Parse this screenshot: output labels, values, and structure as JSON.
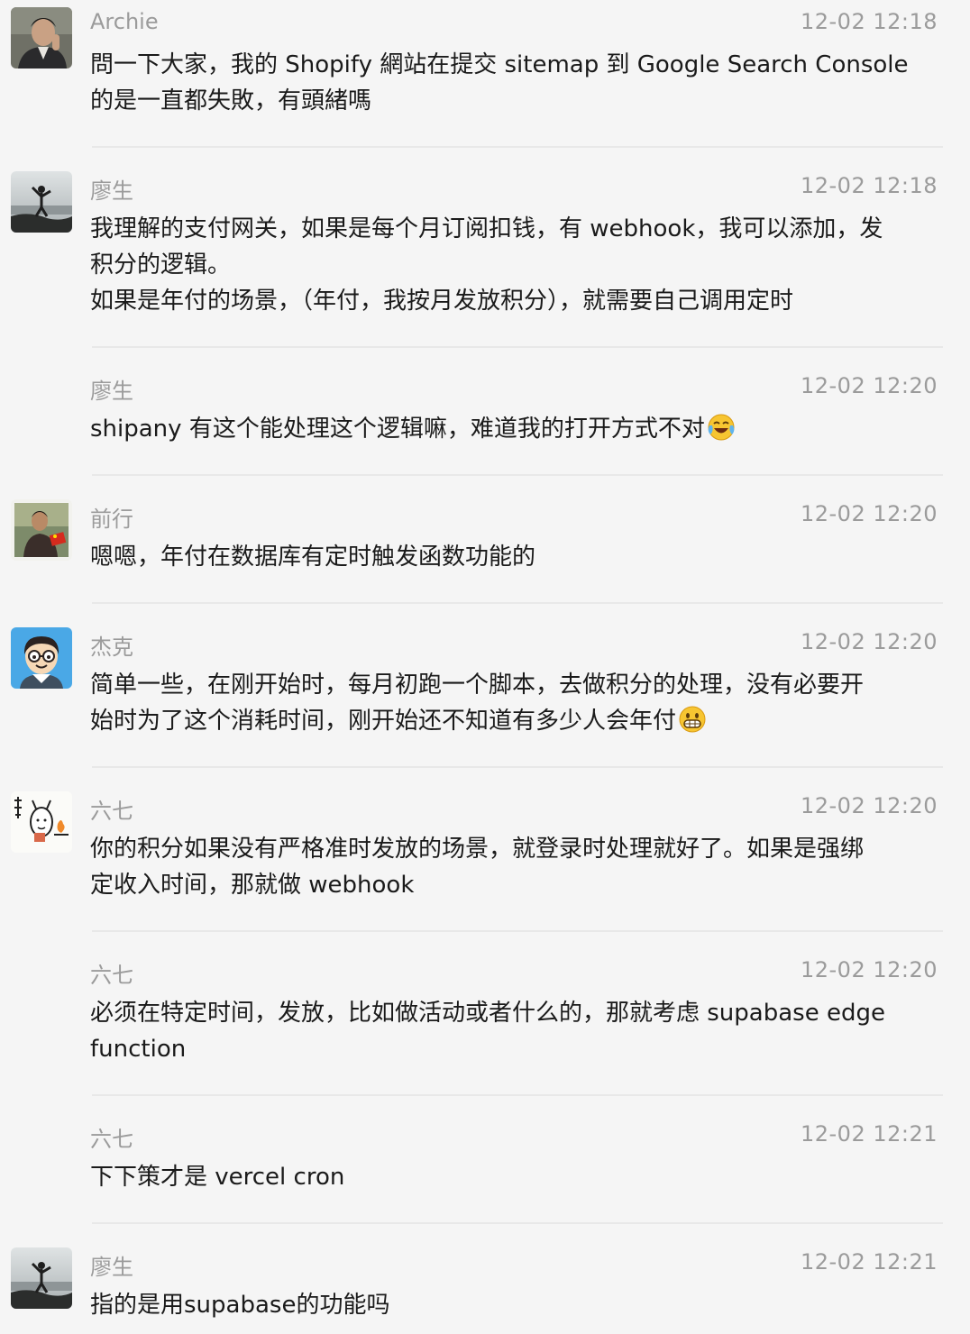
{
  "messages": [
    {
      "sender": "Archie",
      "time": "12-02 12:18",
      "avatar": "avatar-archie",
      "lines": [
        "問一下大家，我的 Shopify 網站在提交 sitemap 到 Google Search Console",
        "的是一直都失敗，有頭緒嗎"
      ]
    },
    {
      "sender": "廖生",
      "time": "12-02 12:18",
      "avatar": "avatar-liaosheng",
      "lines": [
        "我理解的支付网关，如果是每个月订阅扣钱，有 webhook，我可以添加，发",
        "积分的逻辑。",
        "如果是年付的场景，（年付，我按月发放积分），就需要自己调用定时"
      ]
    },
    {
      "sender": "廖生",
      "time": "12-02 12:20",
      "lines": [
        "shipany 有这个能处理这个逻辑嘛，难道我的打开方式不对"
      ],
      "emoji": "crying-laughing-emoji"
    },
    {
      "sender": "前行",
      "time": "12-02 12:20",
      "avatar": "avatar-qianxing",
      "lines": [
        "嗯嗯，年付在数据库有定时触发函数功能的"
      ]
    },
    {
      "sender": "杰克",
      "time": "12-02 12:20",
      "avatar": "avatar-jieke",
      "lines": [
        "简单一些，在刚开始时，每月初跑一个脚本，去做积分的处理，没有必要开",
        "始时为了这个消耗时间，刚开始还不知道有多少人会年付"
      ],
      "emoji": "grinning-emoji"
    },
    {
      "sender": "六七",
      "time": "12-02 12:20",
      "avatar": "avatar-liuqi",
      "lines": [
        "你的积分如果没有严格准时发放的场景，就登录时处理就好了。如果是强绑",
        "定收入时间，那就做 webhook"
      ]
    },
    {
      "sender": "六七",
      "time": "12-02 12:20",
      "lines": [
        "必须在特定时间，发放，比如做活动或者什么的，那就考虑 supabase edge",
        "function"
      ]
    },
    {
      "sender": "六七",
      "time": "12-02 12:21",
      "lines": [
        "下下策才是 vercel cron"
      ]
    },
    {
      "sender": "廖生",
      "time": "12-02 12:21",
      "avatar": "avatar-liaosheng",
      "lines": [
        "指的是用supabase的功能吗"
      ]
    }
  ],
  "colors": {
    "background": "#f5f5f5",
    "meta_text": "#9b9b9b",
    "body_text": "#1a1a1a",
    "divider": "#e8e8e8"
  }
}
